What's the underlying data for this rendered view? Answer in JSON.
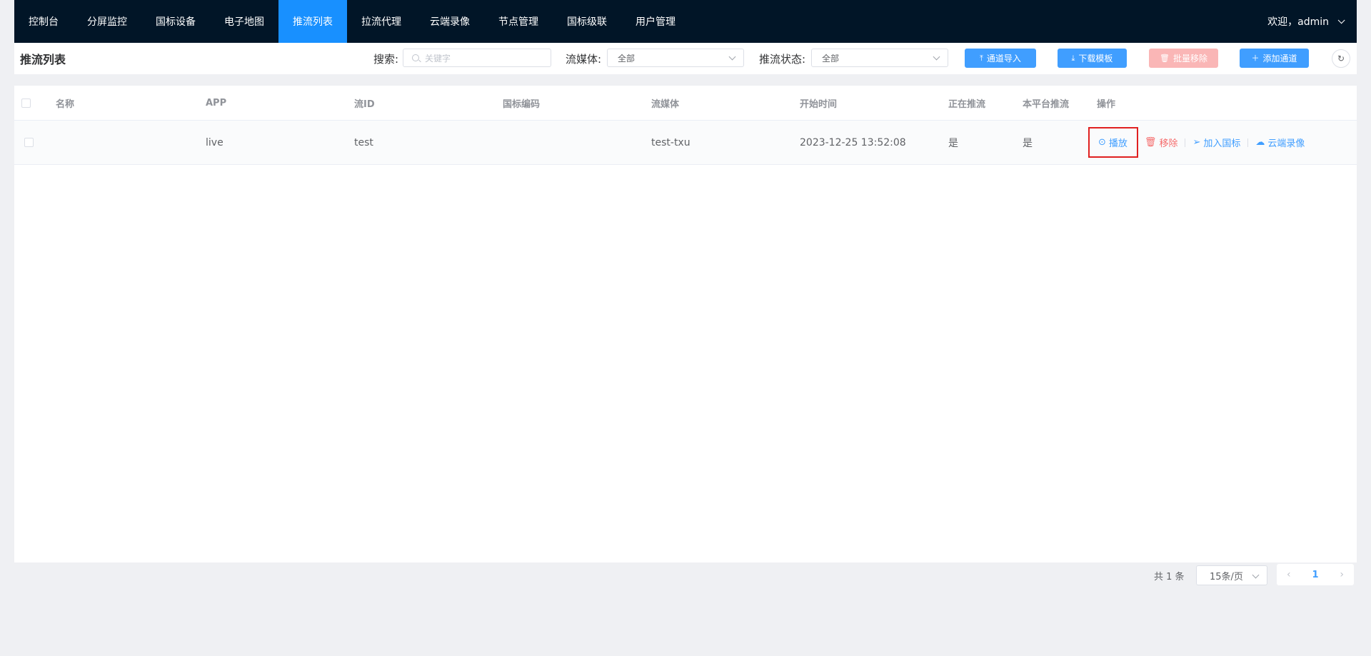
{
  "nav": {
    "items": [
      "控制台",
      "分屏监控",
      "国标设备",
      "电子地图",
      "推流列表",
      "拉流代理",
      "云端录像",
      "节点管理",
      "国标级联",
      "用户管理"
    ],
    "active_index": 4,
    "user_label": "欢迎，admin"
  },
  "toolbar": {
    "title": "推流列表",
    "search_label": "搜索:",
    "search_placeholder": "关键字",
    "media_label": "流媒体:",
    "media_value": "全部",
    "status_label": "推流状态:",
    "status_value": "全部",
    "btn_import": "通道导入",
    "btn_download": "下载模板",
    "btn_batch_remove": "批量移除",
    "btn_add": "添加通道"
  },
  "table": {
    "headers": [
      "名称",
      "APP",
      "流ID",
      "国标编码",
      "流媒体",
      "开始时间",
      "正在推流",
      "本平台推流",
      "操作"
    ],
    "rows": [
      {
        "name": "",
        "app": "live",
        "stream_id": "test",
        "gb_code": "",
        "media": "test-txu",
        "start_time": "2023-12-25 13:52:08",
        "pushing": "是",
        "self_platform": "是"
      }
    ],
    "actions": {
      "play": "播放",
      "remove": "移除",
      "add_gb": "加入国标",
      "cloud_record": "云端录像"
    }
  },
  "pagination": {
    "total_text": "共 1 条",
    "page_size": "15条/页",
    "current_page": "1"
  },
  "colors": {
    "nav_bg": "#011527",
    "nav_active": "#1890ff",
    "primary": "#409eff",
    "danger": "#f56c6c",
    "highlight_box": "#e02020"
  }
}
